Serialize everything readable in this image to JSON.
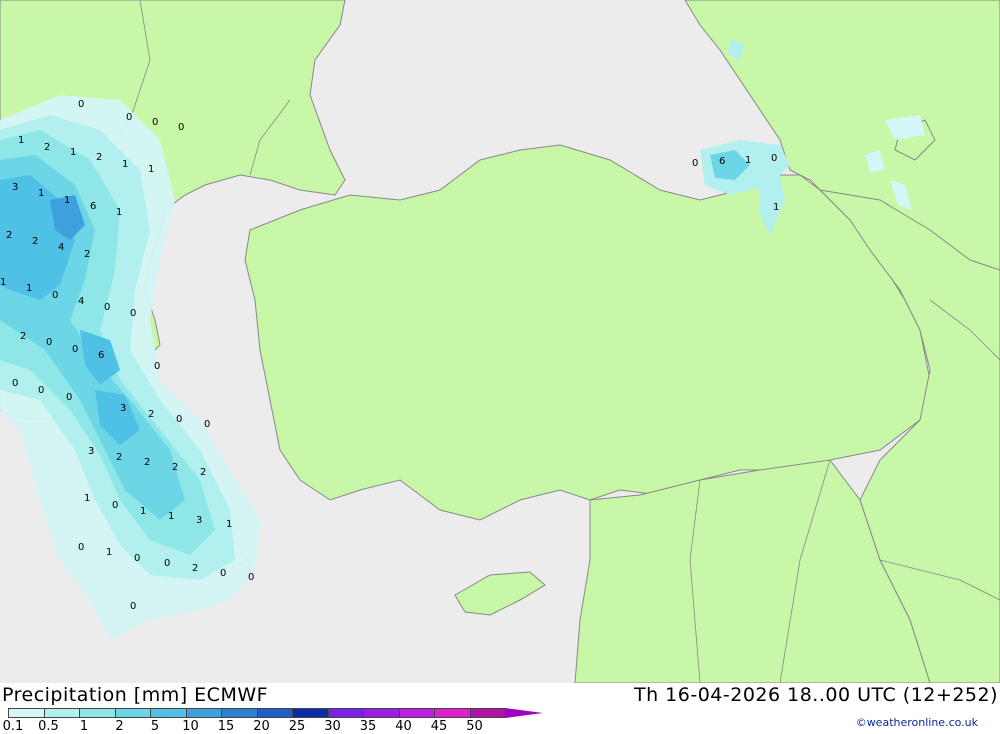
{
  "title": {
    "left": "Precipitation [mm] ECMWF",
    "right": "Th 16-04-2026 18..00 UTC (12+252)"
  },
  "credit": "©weatheronline.co.uk",
  "colors": {
    "sea": "#ececec",
    "land": "#c8f7a8",
    "border": "#888888"
  },
  "legend": {
    "labels": [
      "0.1",
      "0.5",
      "1",
      "2",
      "5",
      "10",
      "15",
      "20",
      "25",
      "30",
      "35",
      "40",
      "45",
      "50"
    ],
    "colors": [
      "#d4f6f6",
      "#b2f0f0",
      "#8ee6e6",
      "#6cd6e6",
      "#4fc0e6",
      "#3ea0dc",
      "#2f7fd2",
      "#1f5ec8",
      "#0a2ca8",
      "#7a22e6",
      "#9a1ee6",
      "#c01ee6",
      "#e01ecf",
      "#b014a6"
    ]
  },
  "values": [
    "0",
    "0",
    "0",
    "0",
    "1",
    "2",
    "1",
    "2",
    "1",
    "1",
    "3",
    "1",
    "1",
    "6",
    "1",
    "2",
    "2",
    "4",
    "2",
    "1",
    "1",
    "0",
    "4",
    "0",
    "0",
    "2",
    "0",
    "0",
    "6",
    "0",
    "0",
    "0",
    "0",
    "3",
    "2",
    "0",
    "0",
    "3",
    "2",
    "2",
    "2",
    "2",
    "1",
    "0",
    "1",
    "1",
    "3",
    "1",
    "0",
    "1",
    "0",
    "2",
    "0",
    "0",
    "0",
    "0",
    "0",
    "6",
    "1",
    "0",
    "1"
  ]
}
